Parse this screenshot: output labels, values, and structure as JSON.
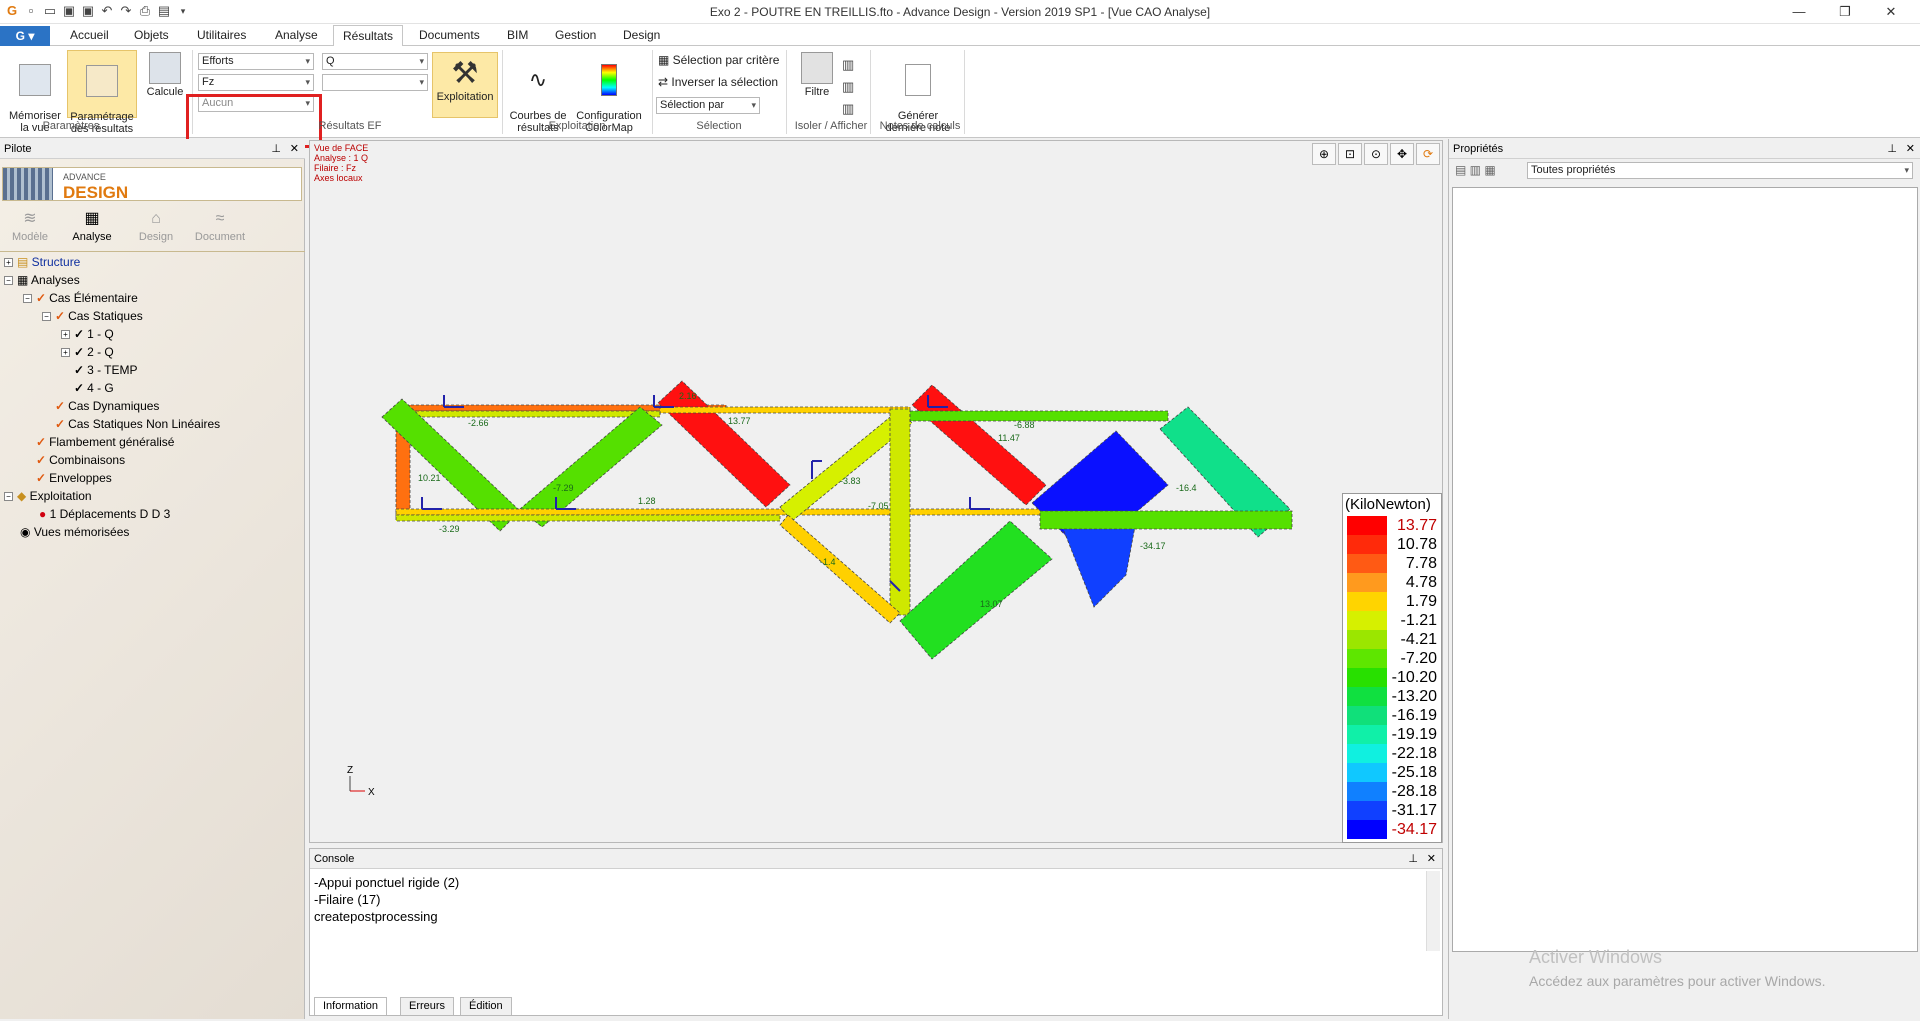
{
  "titlebar": {
    "title": "Exo 2 - POUTRE EN TREILLIS.fto - Advance Design - Version 2019 SP1 - [Vue CAO Analyse]",
    "app_button": "G"
  },
  "tabs": [
    "Accueil",
    "Objets",
    "Utilitaires",
    "Analyse",
    "Résultats",
    "Documents",
    "BIM",
    "Gestion",
    "Design"
  ],
  "active_tab": "Résultats",
  "ribbon": {
    "memoriser": "Mémoriser\nla vue",
    "parametrage": "Paramétrage\ndes résultats",
    "calcule": "Calcule",
    "combo_efforts": "Efforts",
    "combo_fz": "Fz",
    "combo_aucun": "Aucun",
    "combo_q": "Q",
    "exploitation": "Exploitation",
    "courbes": "Courbes de\nrésultats",
    "configuration": "Configuration\nColorMap",
    "selection_critere": "Sélection par critère",
    "inverser": "Inverser la sélection",
    "selection_par": "Sélection par",
    "filtre": "Filtre",
    "generer": "Générer\ndernière note",
    "groups": {
      "parametres": "Paramètres",
      "resultats_ef": "Résultats EF",
      "exploitation": "Exploitation",
      "selection": "Sélection",
      "isoler": "Isoler / Afficher",
      "notes": "Notes de calculs"
    }
  },
  "pilot": {
    "title": "Pilote",
    "logo_small": "ADVANCE",
    "logo_big": "DESIGN",
    "modes": [
      "Modèle",
      "Analyse",
      "Design",
      "Document"
    ],
    "tree": [
      {
        "label": "Structure",
        "indent": 0
      },
      {
        "label": "Analyses",
        "indent": 0
      },
      {
        "label": "Cas Élémentaire",
        "indent": 1
      },
      {
        "label": "Cas Statiques",
        "indent": 2
      },
      {
        "label": "1 - Q",
        "indent": 3
      },
      {
        "label": "2 - Q",
        "indent": 3
      },
      {
        "label": "3 - TEMP",
        "indent": 3
      },
      {
        "label": "4 - G",
        "indent": 3
      },
      {
        "label": "Cas Dynamiques",
        "indent": 2
      },
      {
        "label": "Cas Statiques Non Linéaires",
        "indent": 2
      },
      {
        "label": "Flambement généralisé",
        "indent": 1
      },
      {
        "label": "Combinaisons",
        "indent": 1
      },
      {
        "label": "Enveloppes",
        "indent": 1
      },
      {
        "label": "Exploitation",
        "indent": 0
      },
      {
        "label": "1 Déplacements D  D  3",
        "indent": 1
      },
      {
        "label": "Vues mémorisées",
        "indent": 0
      }
    ]
  },
  "view": {
    "info": [
      "Vue de FACE",
      "Analyse : 1  Q",
      "Filaire : Fz",
      "Axes locaux"
    ],
    "axis_z": "Z",
    "axis_x": "X",
    "labels": [
      "2.16",
      "-2.66",
      "13.77",
      "-6.88",
      "11.47",
      "-7.29",
      "1.28",
      "-3.83",
      "-7.05",
      "-16.4",
      "-3.29",
      "-1.4",
      "13.07",
      "-34.17",
      "10.21"
    ]
  },
  "legend": {
    "title": "(KiloNewton)",
    "entries": [
      {
        "v": "13.77",
        "c": "#ff0000",
        "red": true
      },
      {
        "v": "10.78",
        "c": "#ff2a0a"
      },
      {
        "v": "7.78",
        "c": "#ff5a14"
      },
      {
        "v": "4.78",
        "c": "#ff9a1e"
      },
      {
        "v": "1.79",
        "c": "#ffd400"
      },
      {
        "v": "-1.21",
        "c": "#d6f000"
      },
      {
        "v": "-4.21",
        "c": "#9be600"
      },
      {
        "v": "-7.20",
        "c": "#5ee600"
      },
      {
        "v": "-10.20",
        "c": "#28e000"
      },
      {
        "v": "-13.20",
        "c": "#10e040"
      },
      {
        "v": "-16.19",
        "c": "#10e07a"
      },
      {
        "v": "-19.19",
        "c": "#10f0a8"
      },
      {
        "v": "-22.18",
        "c": "#10f0e0"
      },
      {
        "v": "-25.18",
        "c": "#10c8ff"
      },
      {
        "v": "-28.18",
        "c": "#1080ff"
      },
      {
        "v": "-31.17",
        "c": "#1040ff"
      },
      {
        "v": "-34.17",
        "c": "#0000ff",
        "red": true
      }
    ]
  },
  "console": {
    "title": "Console",
    "lines": [
      "-Appui ponctuel rigide (2)",
      "-Filaire (17)",
      "createpostprocessing"
    ],
    "tabs": [
      "Information",
      "Erreurs",
      "Édition"
    ]
  },
  "props": {
    "title": "Propriétés",
    "filter": "Toutes propriétés",
    "wm1": "Activer Windows",
    "wm2": "Accédez aux paramètres pour activer Windows."
  }
}
